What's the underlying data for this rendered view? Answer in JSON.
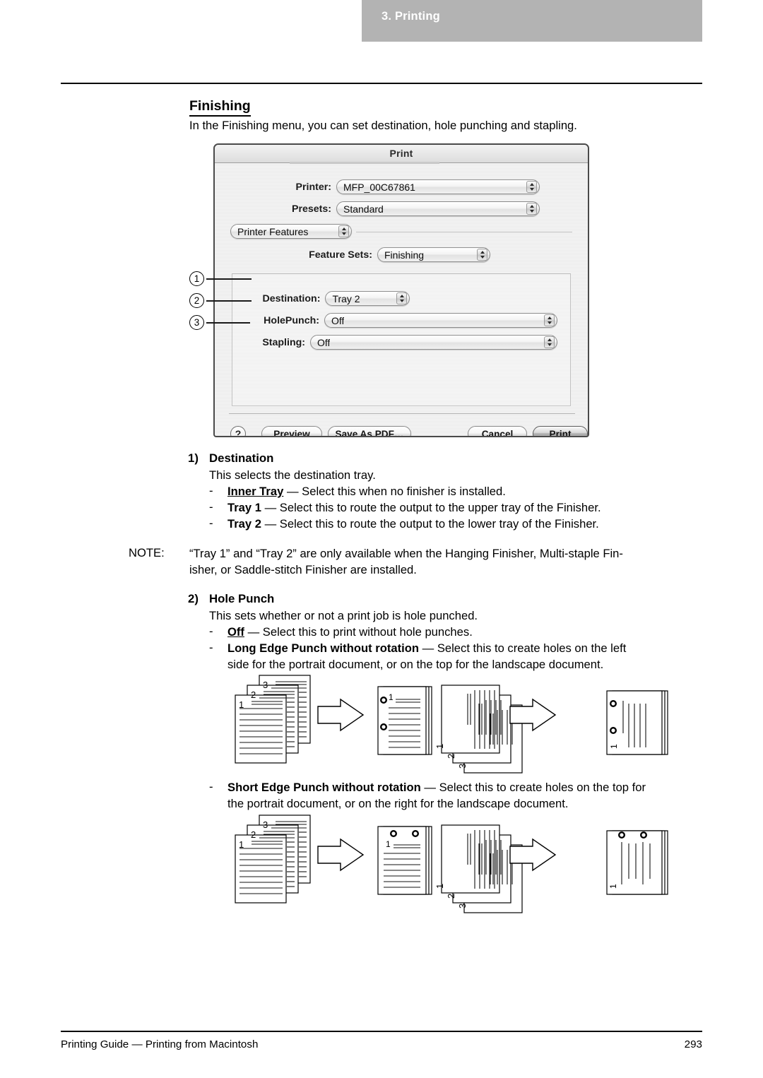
{
  "header": {
    "chapter": "3. Printing"
  },
  "page": {
    "heading": "Finishing",
    "intro": "In the Finishing menu, you can set destination, hole punching and stapling."
  },
  "print_dialog": {
    "title": "Print",
    "fields": {
      "printer_label": "Printer:",
      "printer_value": "MFP_00C67861",
      "presets_label": "Presets:",
      "presets_value": "Standard",
      "pane_value": "Printer Features",
      "feature_sets_label": "Feature Sets:",
      "feature_sets_value": "Finishing",
      "destination_label": "Destination:",
      "destination_value": "Tray 2",
      "holepunch_label": "HolePunch:",
      "holepunch_value": "Off",
      "stapling_label": "Stapling:",
      "stapling_value": "Off"
    },
    "buttons": {
      "help": "?",
      "preview": "Preview",
      "save_as_pdf": "Save As PDF…",
      "cancel": "Cancel",
      "print": "Print"
    },
    "callouts": [
      "1",
      "2",
      "3"
    ]
  },
  "sections": [
    {
      "number": "1)",
      "title": "Destination",
      "body": "This selects the destination tray.",
      "items": [
        {
          "term": "Inner Tray",
          "underline": true,
          "desc": " — Select this when no finisher is installed."
        },
        {
          "term": "Tray 1",
          "underline": false,
          "desc": " — Select this to route the output to the upper tray of the Finisher."
        },
        {
          "term": "Tray 2",
          "underline": false,
          "desc": " — Select this to route the output to the lower tray of the Finisher."
        }
      ]
    },
    {
      "number": "2)",
      "title": "Hole Punch",
      "body": "This sets whether or not a print job is hole punched.",
      "items": [
        {
          "term": "Off",
          "underline": true,
          "desc": " — Select this to print without hole punches."
        },
        {
          "term": "Long Edge Punch without rotation",
          "underline": false,
          "desc": " — Select this to create holes on the left"
        },
        {
          "term": "Short Edge Punch without rotation",
          "underline": false,
          "desc": " — Select this to create holes on the top for"
        }
      ]
    }
  ],
  "note": {
    "label": "NOTE:",
    "line1": "“Tray 1” and “Tray 2” are only available when the Hanging Finisher, Multi-staple Fin-",
    "line2": "isher, or Saddle-stitch Finisher are installed."
  },
  "long_edge": {
    "line2": "side for the portrait document, or on the top for the landscape document."
  },
  "short_edge": {
    "line2": "the portrait document, or on the right for the landscape document."
  },
  "illustrations": {
    "stack_labels": [
      "1",
      "2",
      "3"
    ],
    "output_label": "1"
  },
  "footer": {
    "left": "Printing Guide — Printing from Macintosh",
    "page_number": "293"
  }
}
